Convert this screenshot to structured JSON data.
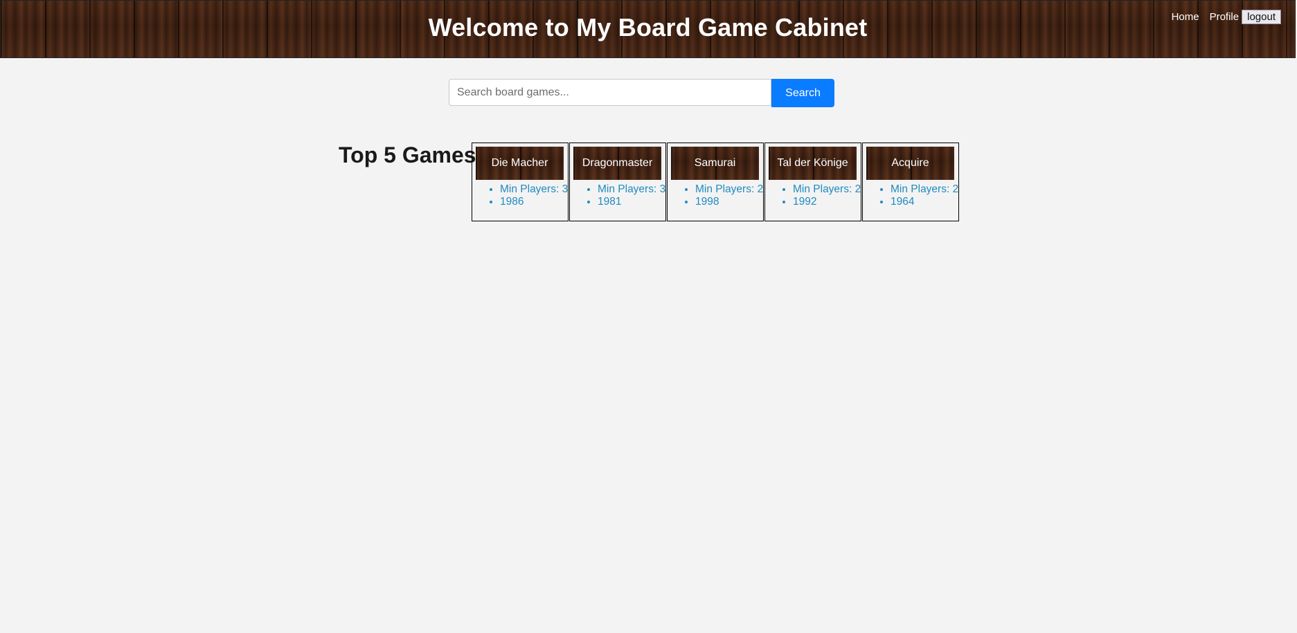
{
  "header": {
    "title": "Welcome to My Board Game Cabinet",
    "nav": {
      "home": "Home",
      "profile": "Profile",
      "logout": "logout"
    }
  },
  "search": {
    "placeholder": "Search board games...",
    "value": "",
    "button_label": "Search",
    "button_color": "#0a7cff"
  },
  "top_games": {
    "title": "Top 5 Games",
    "games": [
      {
        "name": "Die Macher",
        "min_players": "Min Players: 3",
        "year": "1986"
      },
      {
        "name": "Dragonmaster",
        "min_players": "Min Players: 3",
        "year": "1981"
      },
      {
        "name": "Samurai",
        "min_players": "Min Players: 2",
        "year": "1998"
      },
      {
        "name": "Tal der Könige",
        "min_players": "Min Players: 2",
        "year": "1992"
      },
      {
        "name": "Acquire",
        "min_players": "Min Players: 2",
        "year": "1964"
      }
    ]
  },
  "colors": {
    "background": "#f3f3f3",
    "link_text": "#1f8ac0"
  }
}
